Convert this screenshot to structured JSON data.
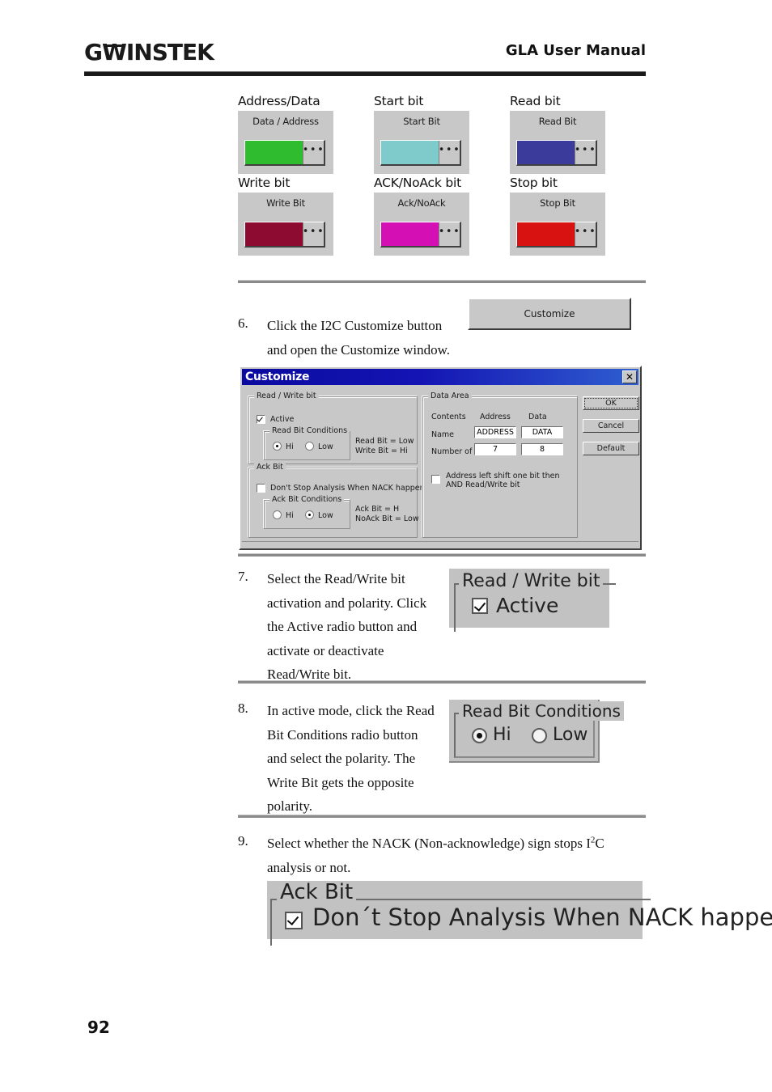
{
  "header": {
    "logo_text_1": "G",
    "logo_text_u": "W",
    "logo_text_2": "INSTEK",
    "title": "GLA User Manual"
  },
  "swatches": {
    "rows": [
      [
        {
          "caption": "Address/Data",
          "panel_title": "Data / Address",
          "color": "#2fbd2f",
          "ellipsis": "•••",
          "name": "address-data-color"
        },
        {
          "caption": "Start bit",
          "panel_title": "Start Bit",
          "color": "#7fcbcb",
          "ellipsis": "•••",
          "name": "start-bit-color"
        },
        {
          "caption": "Read bit",
          "panel_title": "Read Bit",
          "color": "#3b3b9c",
          "ellipsis": "•••",
          "name": "read-bit-color"
        }
      ],
      [
        {
          "caption": "Write bit",
          "panel_title": "Write Bit",
          "color": "#8d0a31",
          "ellipsis": "•••",
          "name": "write-bit-color"
        },
        {
          "caption": "ACK/NoAck bit",
          "panel_title": "Ack/NoAck",
          "color": "#d410b4",
          "ellipsis": "•••",
          "name": "ack-noack-bit-color"
        },
        {
          "caption": "Stop bit",
          "panel_title": "Stop Bit",
          "color": "#d81210",
          "ellipsis": "•••",
          "name": "stop-bit-color"
        }
      ]
    ]
  },
  "steps": {
    "six": {
      "number": "6.",
      "line1": "Click the I2C Customize button",
      "line2": "and open the Customize window.",
      "button_label": "Customize"
    },
    "seven": {
      "number": "7.",
      "text": "Select the Read/Write bit activation and polarity. Click the Active radio button and activate or deactivate Read/Write bit.",
      "figure": {
        "legend": "Read / Write bit",
        "checkbox_label": "Active"
      }
    },
    "eight": {
      "number": "8.",
      "text": "In active mode, click the Read Bit Conditions radio button and select the polarity. The Write Bit gets the opposite polarity.",
      "figure": {
        "legend": "Read Bit Conditions",
        "option_hi": "Hi",
        "option_low": "Low",
        "selected": "Hi"
      }
    },
    "nine": {
      "number": "9.",
      "text_part1": "Select whether the NACK (Non-acknowledge) sign stops I",
      "text_sup": "2",
      "text_part2": "C analysis or not.",
      "figure": {
        "legend": "Ack Bit",
        "checkbox_label": "Don´t Stop Analysis When NACK happer"
      }
    }
  },
  "dialog": {
    "title": "Customize",
    "close_glyph": "✕",
    "read_write_group": {
      "legend": "Read / Write bit",
      "active_label": "Active",
      "active_checked": true,
      "conditions_legend": "Read Bit Conditions",
      "option_hi": "Hi",
      "option_low": "Low",
      "selected": "Hi",
      "note_line1": "Read Bit = Low",
      "note_line2": "Write Bit = Hi"
    },
    "ack_group": {
      "legend": "Ack Bit",
      "dont_stop_label": "Don't Stop Analysis When NACK happen",
      "dont_stop_checked": false,
      "conditions_legend": "Ack Bit Conditions",
      "option_hi": "Hi",
      "option_low": "Low",
      "selected": "Low",
      "note_line1": "Ack Bit = H",
      "note_line2": "NoAck Bit = Low"
    },
    "data_area": {
      "legend": "Data Area",
      "col_contents": "Contents",
      "col_address": "Address",
      "col_data": "Data",
      "row_name": "Name",
      "row_number_of_bit": "Number of Bit",
      "name_address_value": "ADDRESS",
      "name_data_value": "DATA",
      "bits_address_value": "7",
      "bits_data_value": "8",
      "shift_label_line1": "Address left shift one bit then",
      "shift_label_line2": "AND Read/Write bit",
      "shift_checked": false
    },
    "buttons": {
      "ok": "OK",
      "cancel": "Cancel",
      "default": "Default"
    }
  },
  "footer": {
    "page_number": "92"
  }
}
